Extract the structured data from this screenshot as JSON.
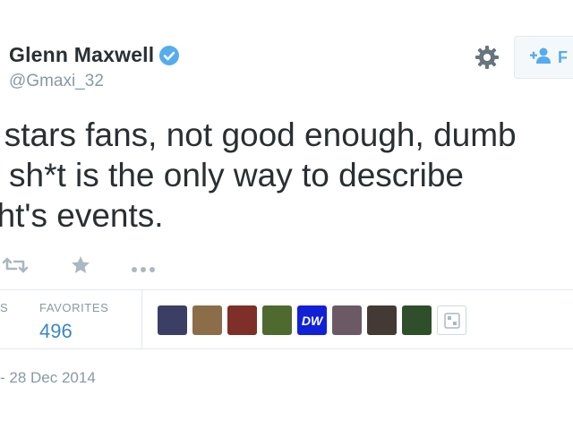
{
  "header": {
    "display_name": "Glenn Maxwell",
    "handle": "@Gmaxi_32",
    "follow_label": "F"
  },
  "tweet": {
    "lines": [
      "y stars fans, not good enough, dumb",
      "sh*t is the only way to describe",
      "ght's events."
    ]
  },
  "stats": {
    "left_label_fragment": "S",
    "favorites_label": "FAVORITES",
    "favorites_count": "496"
  },
  "favoriters": [
    {
      "icon": "avatar-1",
      "color": "#3a3f63"
    },
    {
      "icon": "avatar-2",
      "color": "#8b6d47"
    },
    {
      "icon": "avatar-3",
      "color": "#7d2f28"
    },
    {
      "icon": "avatar-4",
      "color": "#4e6a2f"
    },
    {
      "icon": "avatar-5",
      "color": "#1220d8"
    },
    {
      "icon": "avatar-6",
      "color": "#6b5a66"
    },
    {
      "icon": "avatar-7",
      "color": "#433a35"
    },
    {
      "icon": "avatar-8",
      "color": "#2f4f2b"
    }
  ],
  "avatar_dw_text": "DW",
  "timestamp": "- 28 Dec 2014",
  "colors": {
    "accent": "#55acee",
    "stat_value": "#3b88c3",
    "muted": "#8899a6",
    "text": "#292f33"
  }
}
